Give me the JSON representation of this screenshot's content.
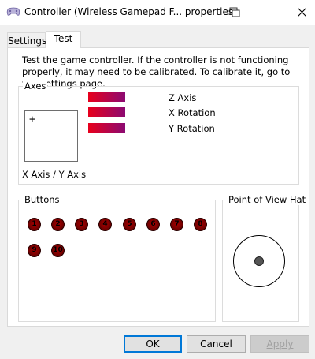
{
  "window": {
    "title": "Controller (Wireless Gamepad F... properties",
    "icons": {
      "app": "gamepad-icon",
      "pin": "window-pin-icon",
      "close": "close-icon"
    }
  },
  "tabs": [
    {
      "label": "Settings",
      "selected": false
    },
    {
      "label": "Test",
      "selected": true
    }
  ],
  "description": "Test the game controller.  If the controller is not functioning properly, it may need to be calibrated.  To calibrate it, go to the Settings page.",
  "axes": {
    "label": "Axes",
    "xy_label": "X Axis / Y Axis",
    "crosshair": "+",
    "bars": [
      {
        "label": "Z Axis"
      },
      {
        "label": "X Rotation"
      },
      {
        "label": "Y Rotation"
      }
    ],
    "bar_colors": {
      "start": "#e8001c",
      "end": "#8b0a72"
    }
  },
  "buttons_group": {
    "label": "Buttons",
    "items": [
      "1",
      "2",
      "3",
      "4",
      "5",
      "6",
      "7",
      "8",
      "9",
      "10"
    ],
    "color": "#8b0000"
  },
  "pov": {
    "label": "Point of View Hat"
  },
  "footer": {
    "ok": "OK",
    "cancel": "Cancel",
    "apply": "Apply",
    "apply_enabled": false
  }
}
